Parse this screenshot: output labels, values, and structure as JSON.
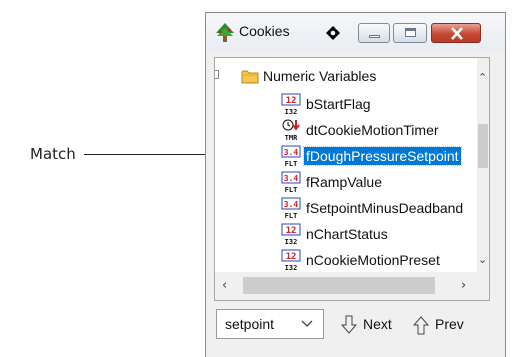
{
  "callout": {
    "label": "Match"
  },
  "window": {
    "title": "Cookies"
  },
  "tree": {
    "group_label": "Numeric Variables",
    "items": [
      {
        "label": "bStartFlag",
        "icon": "int32-variable-icon",
        "type_code": "12",
        "type_text": "I32",
        "selected": false
      },
      {
        "label": "dtCookieMotionTimer",
        "icon": "timer-variable-icon",
        "type_code": "",
        "type_text": "TMR",
        "selected": false
      },
      {
        "label": "fDoughPressureSetpoint",
        "icon": "float-variable-icon",
        "type_code": "3.4",
        "type_text": "FLT",
        "selected": true
      },
      {
        "label": "fRampValue",
        "icon": "float-variable-icon",
        "type_code": "3.4",
        "type_text": "FLT",
        "selected": false
      },
      {
        "label": "fSetpointMinusDeadband",
        "icon": "float-variable-icon",
        "type_code": "3.4",
        "type_text": "FLT",
        "selected": false
      },
      {
        "label": "nChartStatus",
        "icon": "int32-variable-icon",
        "type_code": "12",
        "type_text": "I32",
        "selected": false
      },
      {
        "label": "nCookieMotionPreset",
        "icon": "int32-variable-icon",
        "type_code": "12",
        "type_text": "I32",
        "selected": false
      }
    ]
  },
  "search": {
    "value": "setpoint"
  },
  "nav": {
    "next_label": "Next",
    "prev_label": "Prev"
  },
  "colors": {
    "selection": "#0078d7",
    "close_button": "#c54a35",
    "accent_red": "#d21f1f"
  }
}
